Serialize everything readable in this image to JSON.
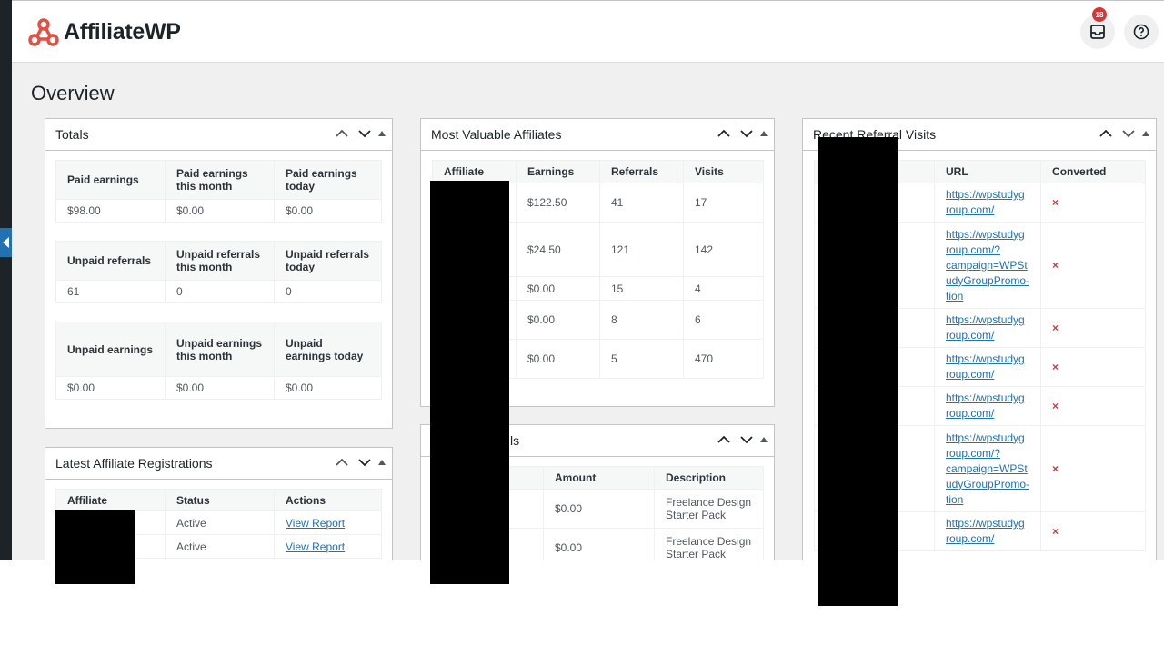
{
  "brand": {
    "name": "AffiliateWP",
    "accent": "#e34f43"
  },
  "header": {
    "notification_count": "18",
    "inbox_icon": "inbox-icon",
    "help_icon": "help-icon"
  },
  "page": {
    "title": "Overview"
  },
  "totals": {
    "title": "Totals",
    "tables": [
      {
        "headers": [
          "Paid earnings",
          "Paid earnings this month",
          "Paid earnings today"
        ],
        "values": [
          "$98.00",
          "$0.00",
          "$0.00"
        ]
      },
      {
        "headers": [
          "Unpaid referrals",
          "Unpaid referrals this month",
          "Unpaid referrals today"
        ],
        "values": [
          "61",
          "0",
          "0"
        ]
      },
      {
        "headers": [
          "Unpaid earnings",
          "Unpaid earnings this month",
          "Unpaid earnings today"
        ],
        "values": [
          "$0.00",
          "$0.00",
          "$0.00"
        ]
      }
    ]
  },
  "latest_registrations": {
    "title": "Latest Affiliate Registrations",
    "headers": [
      "Affiliate",
      "Status",
      "Actions"
    ],
    "rows": [
      {
        "status": "Active",
        "action": "View Report"
      },
      {
        "status": "Active",
        "action": "View Report"
      }
    ]
  },
  "most_valuable": {
    "title": "Most Valuable Affiliates",
    "headers": [
      "Affiliate",
      "Earnings",
      "Referrals",
      "Visits"
    ],
    "rows": [
      {
        "earnings": "$122.50",
        "referrals": "41",
        "visits": "17"
      },
      {
        "earnings": "$24.50",
        "referrals": "121",
        "visits": "142"
      },
      {
        "earnings": "$0.00",
        "referrals": "15",
        "visits": "4"
      },
      {
        "earnings": "$0.00",
        "referrals": "8",
        "visits": "6"
      },
      {
        "earnings": "$0.00",
        "referrals": "5",
        "visits": "470"
      }
    ]
  },
  "referrals_widget": {
    "title_visible": "ls",
    "headers": [
      "Amount",
      "Description"
    ],
    "rows": [
      {
        "amount": "$0.00",
        "description": "Freelance Design Starter Pack"
      },
      {
        "amount": "$0.00",
        "description": "Freelance Design Starter Pack"
      }
    ]
  },
  "recent_visits": {
    "title": "Recent Referral Visits",
    "headers": [
      "URL",
      "Converted"
    ],
    "rows": [
      {
        "url": "https://wpstudygroup.com/",
        "url_lines": [
          "https://wpstudyg",
          "roup.com/"
        ],
        "converted": "×"
      },
      {
        "url": "https://wpstudygroup.com/?campaign=WPStudyGroupPromotion",
        "url_lines": [
          "https://wpstudyg",
          "roup.com/?",
          "campaign=WPSt",
          "udyGroupPromo-",
          "tion"
        ],
        "converted": "×"
      },
      {
        "url": "https://wpstudygroup.com/",
        "url_lines": [
          "https://wpstudyg",
          "roup.com/"
        ],
        "converted": "×"
      },
      {
        "url": "https://wpstudygroup.com/",
        "url_lines": [
          "https://wpstudyg",
          "roup.com/"
        ],
        "converted": "×"
      },
      {
        "url": "https://wpstudygroup.com/",
        "url_lines": [
          "https://wpstudyg",
          "roup.com/"
        ],
        "converted": "×"
      },
      {
        "url": "https://wpstudygroup.com/?campaign=WPStudyGroupPromotion",
        "url_lines": [
          "https://wpstudyg",
          "roup.com/?",
          "campaign=WPSt",
          "udyGroupPromo-",
          "tion"
        ],
        "converted": "×"
      },
      {
        "url": "https://wpstudygroup.com/",
        "url_lines": [
          "https://wpstudyg",
          "roup.com/"
        ],
        "converted": "×"
      }
    ]
  },
  "widget_controls": {
    "up": "chevron-up-icon",
    "down": "chevron-down-icon",
    "toggle": "toggle-arrow-icon"
  }
}
